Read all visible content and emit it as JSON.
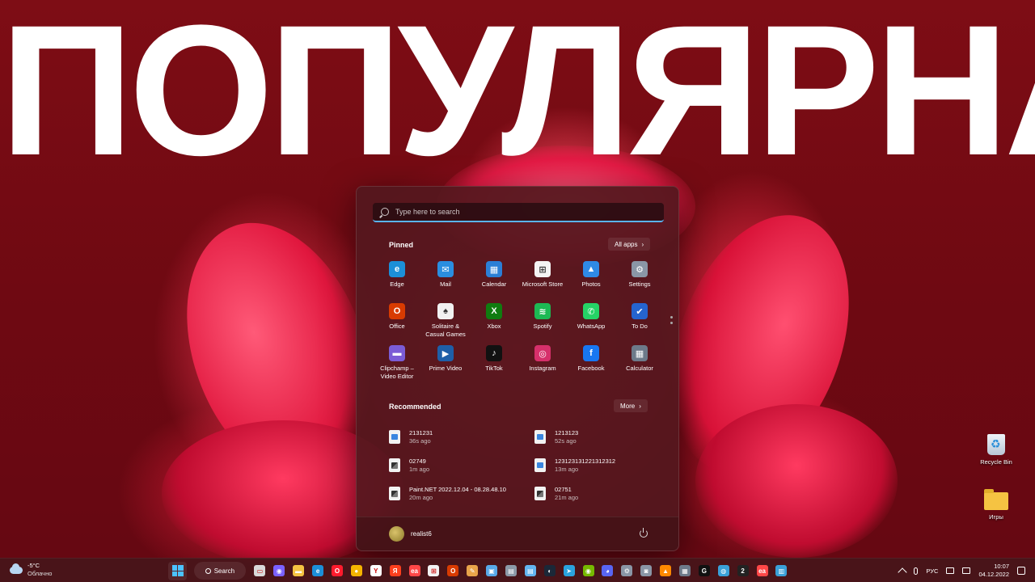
{
  "overlay": {
    "title": "ПОПУЛЯРНА"
  },
  "start_menu": {
    "search_placeholder": "Type here to search",
    "pinned_title": "Pinned",
    "all_apps_label": "All apps",
    "pinned_apps": [
      {
        "label": "Edge",
        "icon": "edge-icon",
        "color": "#1c8fd8",
        "glyph": "e"
      },
      {
        "label": "Mail",
        "icon": "mail-icon",
        "color": "#2a8ee0",
        "glyph": "✉"
      },
      {
        "label": "Calendar",
        "icon": "calendar-icon",
        "color": "#2b7fd6",
        "glyph": "▦"
      },
      {
        "label": "Microsoft Store",
        "icon": "store-icon",
        "color": "#f3f3f3",
        "glyph": "⊞"
      },
      {
        "label": "Photos",
        "icon": "photos-icon",
        "color": "#2f8ae6",
        "glyph": "▲"
      },
      {
        "label": "Settings",
        "icon": "gear-icon",
        "color": "#8a96a6",
        "glyph": "⚙"
      },
      {
        "label": "Office",
        "icon": "office-icon",
        "color": "#d83b01",
        "glyph": "O"
      },
      {
        "label": "Solitaire & Casual Games",
        "icon": "solitaire-icon",
        "color": "#f1f1f1",
        "glyph": "♠"
      },
      {
        "label": "Xbox",
        "icon": "xbox-icon",
        "color": "#107c10",
        "glyph": "X"
      },
      {
        "label": "Spotify",
        "icon": "spotify-icon",
        "color": "#1db954",
        "glyph": "≋"
      },
      {
        "label": "WhatsApp",
        "icon": "whatsapp-icon",
        "color": "#25d366",
        "glyph": "✆"
      },
      {
        "label": "To Do",
        "icon": "todo-icon",
        "color": "#2564cf",
        "glyph": "✔"
      },
      {
        "label": "Clipchamp – Video Editor",
        "icon": "clipchamp-icon",
        "color": "#7b5cd6",
        "glyph": "▬"
      },
      {
        "label": "Prime Video",
        "icon": "prime-video-icon",
        "color": "#1e5fa8",
        "glyph": "▶"
      },
      {
        "label": "TikTok",
        "icon": "tiktok-icon",
        "color": "#111111",
        "glyph": "♪"
      },
      {
        "label": "Instagram",
        "icon": "instagram-icon",
        "color": "#d6306b",
        "glyph": "◎"
      },
      {
        "label": "Facebook",
        "icon": "facebook-icon",
        "color": "#1877f2",
        "glyph": "f"
      },
      {
        "label": "Calculator",
        "icon": "calculator-icon",
        "color": "#6d7a8a",
        "glyph": "▦"
      }
    ],
    "recommended_title": "Recommended",
    "more_label": "More",
    "recommended": [
      {
        "name": "2131231",
        "time": "36s ago",
        "kind": "img"
      },
      {
        "name": "1213123",
        "time": "52s ago",
        "kind": "img"
      },
      {
        "name": "02749",
        "time": "1m ago",
        "kind": "pdn"
      },
      {
        "name": "123123131221312312",
        "time": "13m ago",
        "kind": "img"
      },
      {
        "name": "Paint.NET 2022.12.04 - 08.28.48.10",
        "time": "20m ago",
        "kind": "pdn"
      },
      {
        "name": "02751",
        "time": "21m ago",
        "kind": "pdn"
      }
    ],
    "user_name": "realist6"
  },
  "desktop": {
    "recycle_bin": "Recycle Bin",
    "games_folder": "Игры"
  },
  "taskbar": {
    "weather_temp": "-5°C",
    "weather_cond": "Облачно",
    "search_label": "Search",
    "apps": [
      {
        "name": "task-view-icon",
        "color": "#d9d9d9",
        "glyph": "▭"
      },
      {
        "name": "chat-icon",
        "color": "#7b61ff",
        "glyph": "◉"
      },
      {
        "name": "file-explorer-icon",
        "color": "#f5c342",
        "glyph": "▬"
      },
      {
        "name": "edge-icon",
        "color": "#1c8fd8",
        "glyph": "e"
      },
      {
        "name": "opera-icon",
        "color": "#ff1b2d",
        "glyph": "O"
      },
      {
        "name": "chrome-icon",
        "color": "#f4b400",
        "glyph": "●"
      },
      {
        "name": "yandex-icon",
        "color": "#ffffff",
        "glyph": "Y"
      },
      {
        "name": "yandex-browser-icon",
        "color": "#fc3f1d",
        "glyph": "Я"
      },
      {
        "name": "ea-icon",
        "color": "#ff4747",
        "glyph": "ea"
      },
      {
        "name": "store-icon",
        "color": "#f3f3f3",
        "glyph": "⊞"
      },
      {
        "name": "office-icon",
        "color": "#d83b01",
        "glyph": "O"
      },
      {
        "name": "paint-icon",
        "color": "#e8a44a",
        "glyph": "✎"
      },
      {
        "name": "monitor-icon",
        "color": "#58a9e8",
        "glyph": "▣"
      },
      {
        "name": "paint-net-icon",
        "color": "#8c9aa8",
        "glyph": "▤"
      },
      {
        "name": "notepad-icon",
        "color": "#63b5f0",
        "glyph": "▤"
      },
      {
        "name": "steam-icon",
        "color": "#1b2838",
        "glyph": "◐"
      },
      {
        "name": "telegram-icon",
        "color": "#2aa3de",
        "glyph": "➤"
      },
      {
        "name": "nvidia-icon",
        "color": "#76b900",
        "glyph": "◉"
      },
      {
        "name": "discord-icon",
        "color": "#5865f2",
        "glyph": "◕"
      },
      {
        "name": "settings-icon",
        "color": "#8a96a6",
        "glyph": "⚙"
      },
      {
        "name": "camera-icon",
        "color": "#8a96a6",
        "glyph": "◙"
      },
      {
        "name": "vlc-icon",
        "color": "#ff8800",
        "glyph": "▲"
      },
      {
        "name": "calculator-icon",
        "color": "#6d7a8a",
        "glyph": "▦"
      },
      {
        "name": "g-hub-icon",
        "color": "#111111",
        "glyph": "G"
      },
      {
        "name": "globe-icon",
        "color": "#3aa0d8",
        "glyph": "◍"
      },
      {
        "name": "two-icon",
        "color": "#222222",
        "glyph": "2"
      },
      {
        "name": "ea-app-icon",
        "color": "#ff4747",
        "glyph": "ea"
      },
      {
        "name": "performance-icon",
        "color": "#3aa0d8",
        "glyph": "▥"
      }
    ],
    "lang": "РУС",
    "time": "10:07",
    "date": "04.12.2022"
  }
}
